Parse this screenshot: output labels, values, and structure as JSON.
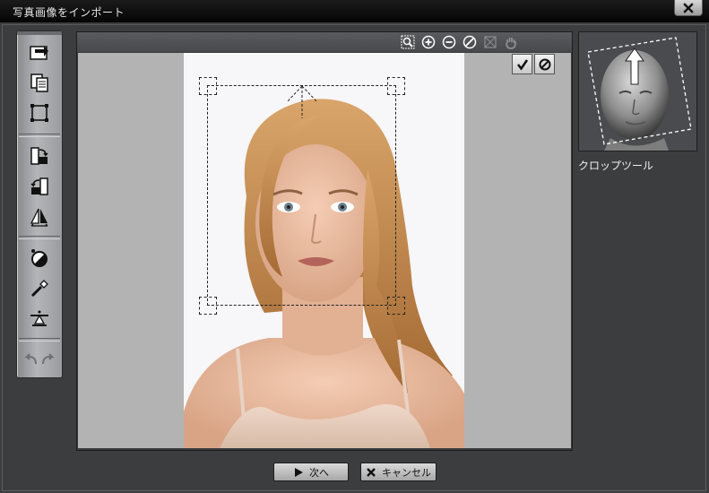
{
  "window": {
    "title": "写真画像をインポート"
  },
  "colors": {
    "window_bg": "#3c3d3f",
    "title_bar": "#0b0b0b",
    "canvas_bg": "#b3b3b3",
    "toolbar": "#a8a9ac"
  },
  "left_toolbar": {
    "tools": [
      {
        "icon": "import-photo-icon"
      },
      {
        "icon": "copy-icon"
      },
      {
        "icon": "crop-icon"
      },
      {
        "icon": "rotate-right-icon"
      },
      {
        "icon": "rotate-left-icon"
      },
      {
        "icon": "flip-icon"
      },
      {
        "icon": "contrast-icon"
      },
      {
        "icon": "eyedropper-icon"
      },
      {
        "icon": "level-icon"
      },
      {
        "icon": "undo-icon"
      },
      {
        "icon": "redo-icon"
      }
    ]
  },
  "canvas_toolbar": {
    "icons": [
      "zoom-fit-icon",
      "zoom-in-icon",
      "zoom-out-icon",
      "reset-icon",
      "frame-icon",
      "hand-icon"
    ]
  },
  "crop": {
    "confirm_icon": "checkmark-icon",
    "cancel_icon": "cancel-icon"
  },
  "preview": {
    "label": "クロップツール"
  },
  "buttons": {
    "next_label": "次へ",
    "cancel_label": "キャンセル"
  }
}
